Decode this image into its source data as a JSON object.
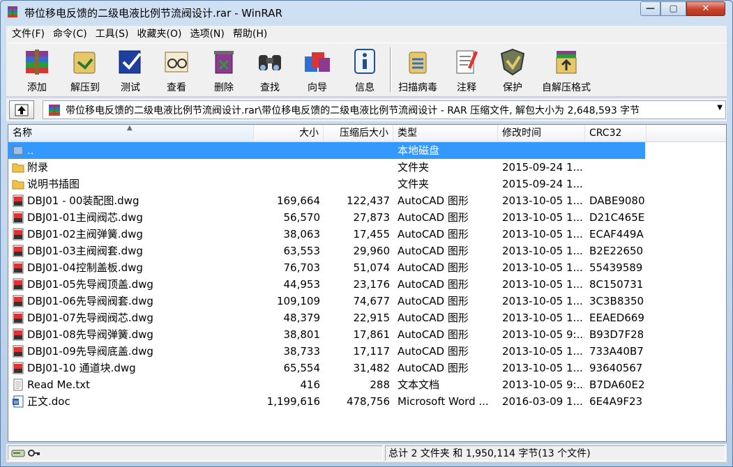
{
  "window": {
    "title": "带位移电反馈的二级电液比例节流阀设计.rar - WinRAR",
    "close_glyph": "✕",
    "max_glyph": "▢",
    "min_glyph": "—"
  },
  "menu": [
    {
      "label": "文件(F)"
    },
    {
      "label": "命令(C)"
    },
    {
      "label": "工具(S)"
    },
    {
      "label": "收藏夹(O)"
    },
    {
      "label": "选项(N)"
    },
    {
      "label": "帮助(H)"
    }
  ],
  "toolbar": [
    {
      "label": "添加",
      "icon": "add-archive-icon"
    },
    {
      "label": "解压到",
      "icon": "extract-to-icon"
    },
    {
      "label": "测试",
      "icon": "test-icon"
    },
    {
      "label": "查看",
      "icon": "view-icon"
    },
    {
      "label": "删除",
      "icon": "delete-icon"
    },
    {
      "label": "查找",
      "icon": "find-icon"
    },
    {
      "label": "向导",
      "icon": "wizard-icon"
    },
    {
      "label": "信息",
      "icon": "info-icon"
    },
    {
      "label": "扫描病毒",
      "icon": "virus-scan-icon"
    },
    {
      "label": "注释",
      "icon": "comment-icon"
    },
    {
      "label": "保护",
      "icon": "protect-icon"
    },
    {
      "label": "自解压格式",
      "icon": "sfx-icon"
    }
  ],
  "address": {
    "path": "带位移电反馈的二级电液比例节流阀设计.rar\\带位移电反馈的二级电液比例节流阀设计 - RAR 压缩文件, 解包大小为 2,648,593 字节"
  },
  "columns": {
    "name": "名称",
    "size": "大小",
    "packed": "压缩后大小",
    "type": "类型",
    "modified": "修改时间",
    "crc": "CRC32"
  },
  "files": [
    {
      "name": "..",
      "size": "",
      "packed": "",
      "type": "本地磁盘",
      "modified": "",
      "crc": "",
      "icon": "parent-folder-icon",
      "selected": true
    },
    {
      "name": "附录",
      "size": "",
      "packed": "",
      "type": "文件夹",
      "modified": "2015-09-24 1...",
      "crc": "",
      "icon": "folder-icon"
    },
    {
      "name": "说明书插图",
      "size": "",
      "packed": "",
      "type": "文件夹",
      "modified": "2015-09-24 1...",
      "crc": "",
      "icon": "folder-icon"
    },
    {
      "name": "DBJ01 - 00装配图.dwg",
      "size": "169,664",
      "packed": "122,437",
      "type": "AutoCAD 图形",
      "modified": "2013-10-05 1...",
      "crc": "DABE9080",
      "icon": "dwg-file-icon"
    },
    {
      "name": "DBJ01-01主阀阀芯.dwg",
      "size": "56,570",
      "packed": "27,873",
      "type": "AutoCAD 图形",
      "modified": "2013-10-05 1...",
      "crc": "D21C465E",
      "icon": "dwg-file-icon"
    },
    {
      "name": "DBJ01-02主阀弹簧.dwg",
      "size": "38,063",
      "packed": "17,455",
      "type": "AutoCAD 图形",
      "modified": "2013-10-05 1...",
      "crc": "ECAF449A",
      "icon": "dwg-file-icon"
    },
    {
      "name": "DBJ01-03主阀阀套.dwg",
      "size": "63,553",
      "packed": "29,960",
      "type": "AutoCAD 图形",
      "modified": "2013-10-05 1...",
      "crc": "B2E22650",
      "icon": "dwg-file-icon"
    },
    {
      "name": "DBJ01-04控制盖板.dwg",
      "size": "76,703",
      "packed": "51,074",
      "type": "AutoCAD 图形",
      "modified": "2013-10-05 1...",
      "crc": "55439589",
      "icon": "dwg-file-icon"
    },
    {
      "name": "DBJ01-05先导阀顶盖.dwg",
      "size": "44,953",
      "packed": "23,176",
      "type": "AutoCAD 图形",
      "modified": "2013-10-05 1...",
      "crc": "8C150731",
      "icon": "dwg-file-icon"
    },
    {
      "name": "DBJ01-06先导阀阀套.dwg",
      "size": "109,109",
      "packed": "74,677",
      "type": "AutoCAD 图形",
      "modified": "2013-10-05 1...",
      "crc": "3C3B8350",
      "icon": "dwg-file-icon"
    },
    {
      "name": "DBJ01-07先导阀阀芯.dwg",
      "size": "48,379",
      "packed": "22,915",
      "type": "AutoCAD 图形",
      "modified": "2013-10-05 1...",
      "crc": "EEAED669",
      "icon": "dwg-file-icon"
    },
    {
      "name": "DBJ01-08先导阀弹簧.dwg",
      "size": "38,801",
      "packed": "17,861",
      "type": "AutoCAD 图形",
      "modified": "2013-10-05 9:...",
      "crc": "B93D7F28",
      "icon": "dwg-file-icon"
    },
    {
      "name": "DBJ01-09先导阀底盖.dwg",
      "size": "38,733",
      "packed": "17,117",
      "type": "AutoCAD 图形",
      "modified": "2013-10-05 1...",
      "crc": "733A40B7",
      "icon": "dwg-file-icon"
    },
    {
      "name": "DBJ01-10 通道块.dwg",
      "size": "65,554",
      "packed": "31,482",
      "type": "AutoCAD 图形",
      "modified": "2013-10-05 1...",
      "crc": "93640567",
      "icon": "dwg-file-icon"
    },
    {
      "name": "Read Me.txt",
      "size": "416",
      "packed": "288",
      "type": "文本文档",
      "modified": "2013-10-05 9:...",
      "crc": "B7DA60E2",
      "icon": "txt-file-icon"
    },
    {
      "name": "正文.doc",
      "size": "1,199,616",
      "packed": "478,756",
      "type": "Microsoft Word ...",
      "modified": "2016-03-09 1...",
      "crc": "6E4A9F23",
      "icon": "word-file-icon"
    }
  ],
  "status": {
    "summary": "总计 2 文件夹 和 1,950,114 字节(13 个文件)"
  },
  "colors": {
    "selection": "#3399ff",
    "window_frame": "#b9d1ea",
    "close_button": "#c9402b"
  }
}
